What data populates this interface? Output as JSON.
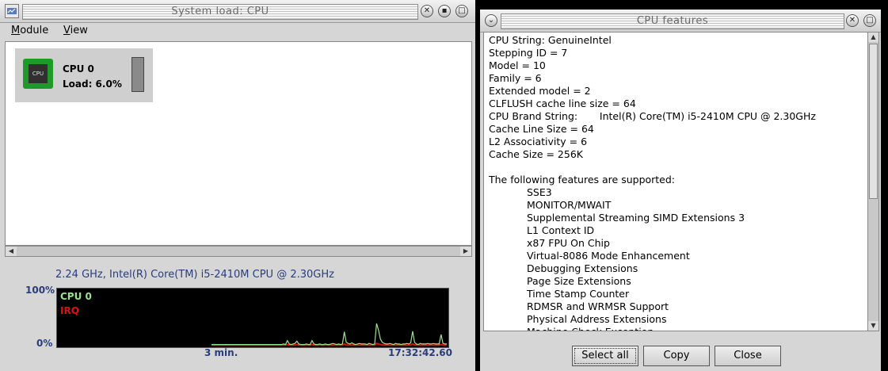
{
  "window_left": {
    "title": "System load: CPU",
    "menu": [
      "Module",
      "View"
    ],
    "cpu_card": {
      "name": "CPU 0",
      "load": "Load: 6.0%",
      "chip_text": "CPU"
    },
    "cpu_info": "2.24 GHz, Intel(R) Core(TM) i5-2410M CPU @ 2.30GHz",
    "graph": {
      "y_max_label": "100%",
      "y_min_label": "0%",
      "legend": [
        {
          "name": "CPU 0",
          "color": "#9be28f"
        },
        {
          "name": "IRQ",
          "color": "#e01010"
        }
      ],
      "time_span": "3 min.",
      "timestamp": "17:32:42.60"
    }
  },
  "window_right": {
    "title": "CPU features",
    "lines": [
      "CPU String: GenuineIntel",
      "Stepping ID = 7",
      "Model = 10",
      "Family = 6",
      "Extended model = 2",
      "CLFLUSH cache line size = 64",
      "CPU Brand String:       Intel(R) Core(TM) i5-2410M CPU @ 2.30GHz",
      "Cache Line Size = 64",
      "L2 Associativity = 6",
      "Cache Size = 256K",
      "",
      "The following features are supported:"
    ],
    "features": [
      "SSE3",
      "MONITOR/MWAIT",
      "Supplemental Streaming SIMD Extensions 3",
      "L1 Context ID",
      "x87 FPU On Chip",
      "Virtual-8086 Mode Enhancement",
      "Debugging Extensions",
      "Page Size Extensions",
      "Time Stamp Counter",
      "RDMSR and WRMSR Support",
      "Physical Address Extensions",
      "Machine Check Exception"
    ],
    "buttons": {
      "select_all": "Select all",
      "copy": "Copy",
      "close": "Close"
    }
  },
  "chart_data": {
    "type": "line",
    "series": [
      {
        "name": "CPU 0",
        "values": [
          2,
          2,
          2,
          2,
          2,
          2,
          2,
          2,
          2,
          2,
          2,
          2,
          2,
          2,
          2,
          2,
          2,
          2,
          2,
          2,
          2,
          2,
          2,
          2,
          2,
          2,
          2,
          2,
          2,
          2,
          2,
          2,
          2,
          2,
          2,
          2,
          2,
          2,
          3,
          2,
          9,
          3,
          2,
          3,
          4,
          8,
          3,
          2,
          2,
          2,
          3,
          2,
          2,
          9,
          3,
          2,
          2,
          3,
          2,
          2,
          3,
          2,
          2,
          3,
          4,
          3,
          2,
          3,
          2,
          3,
          25,
          6,
          4,
          3,
          5,
          3,
          2,
          3,
          4,
          3,
          3,
          3,
          2,
          4,
          3,
          2,
          3,
          40,
          28,
          12,
          6,
          4,
          3,
          3,
          4,
          3,
          2,
          4,
          3,
          3,
          2,
          3,
          3,
          4,
          3,
          5,
          26,
          6,
          3,
          2,
          4,
          3,
          3,
          3,
          4,
          3,
          3,
          4,
          3,
          3,
          3,
          20,
          4,
          3,
          3
        ]
      },
      {
        "name": "IRQ",
        "values": [
          1,
          1,
          1,
          1,
          1,
          1,
          1,
          1,
          1,
          1,
          1,
          1,
          1,
          1,
          1,
          1,
          1,
          1,
          1,
          1,
          1,
          1,
          1,
          1,
          1,
          1,
          1,
          1,
          1,
          1,
          1,
          1,
          1,
          1,
          1,
          1,
          1,
          1,
          1,
          1,
          2,
          1,
          1,
          1,
          1,
          2,
          1,
          1,
          1,
          1,
          1,
          1,
          1,
          2,
          1,
          1,
          1,
          1,
          1,
          1,
          1,
          1,
          1,
          1,
          1,
          1,
          1,
          1,
          1,
          1,
          3,
          1,
          1,
          1,
          1,
          1,
          1,
          1,
          1,
          1,
          1,
          1,
          1,
          1,
          1,
          1,
          1,
          4,
          3,
          2,
          1,
          1,
          1,
          1,
          1,
          1,
          1,
          1,
          1,
          1,
          1,
          1,
          1,
          1,
          1,
          1,
          3,
          1,
          1,
          1,
          1,
          1,
          1,
          1,
          1,
          1,
          1,
          1,
          1,
          1,
          1,
          2,
          1,
          1,
          1
        ]
      }
    ],
    "ylim": [
      0,
      100
    ],
    "yticks": [
      "100%",
      "0%"
    ]
  }
}
